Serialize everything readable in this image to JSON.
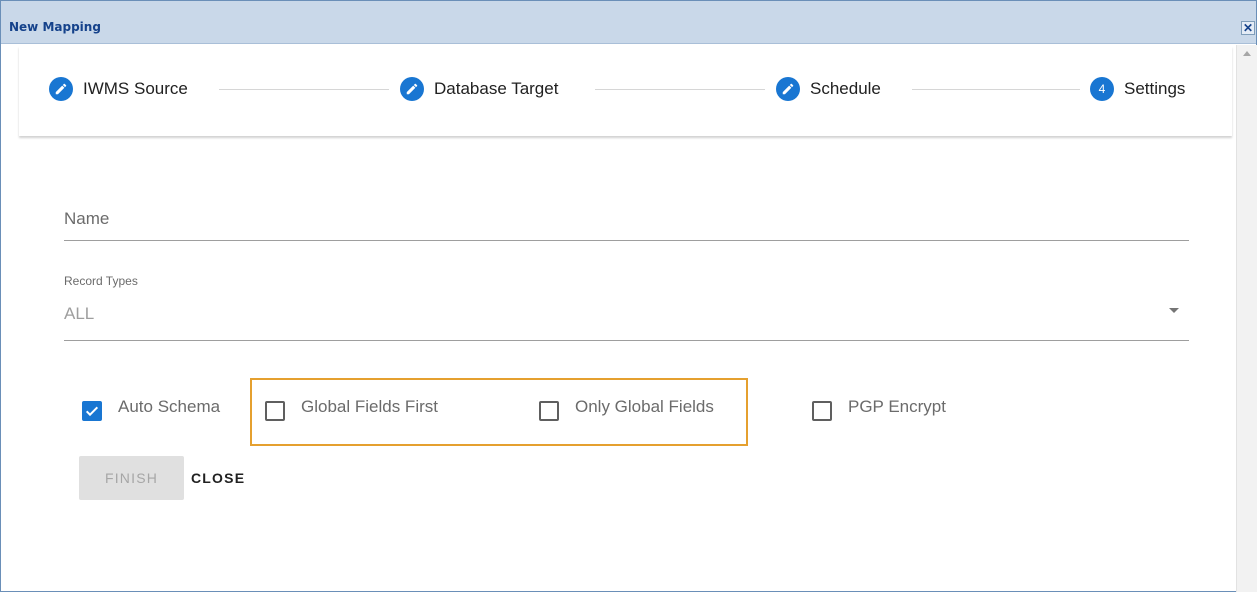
{
  "window": {
    "title": "New Mapping",
    "close_symbol": "✕"
  },
  "stepper": {
    "steps": [
      {
        "label": "IWMS Source",
        "icon": "pencil-icon"
      },
      {
        "label": "Database Target",
        "icon": "pencil-icon"
      },
      {
        "label": "Schedule",
        "icon": "pencil-icon"
      },
      {
        "label": "Settings",
        "number": "4"
      }
    ]
  },
  "form": {
    "name_label": "Name",
    "name_value": "",
    "record_types_label": "Record Types",
    "record_types_value": "ALL"
  },
  "options": {
    "auto_schema": {
      "label": "Auto Schema",
      "checked": true
    },
    "global_fields_first": {
      "label": "Global Fields First",
      "checked": false
    },
    "only_global_fields": {
      "label": "Only Global Fields",
      "checked": false
    },
    "pgp_encrypt": {
      "label": "PGP Encrypt",
      "checked": false
    }
  },
  "actions": {
    "finish_label": "FINISH",
    "close_label": "CLOSE"
  },
  "colors": {
    "accent": "#1976d2",
    "highlight": "#e5a02f",
    "titlebar": "#c9d8e9"
  }
}
